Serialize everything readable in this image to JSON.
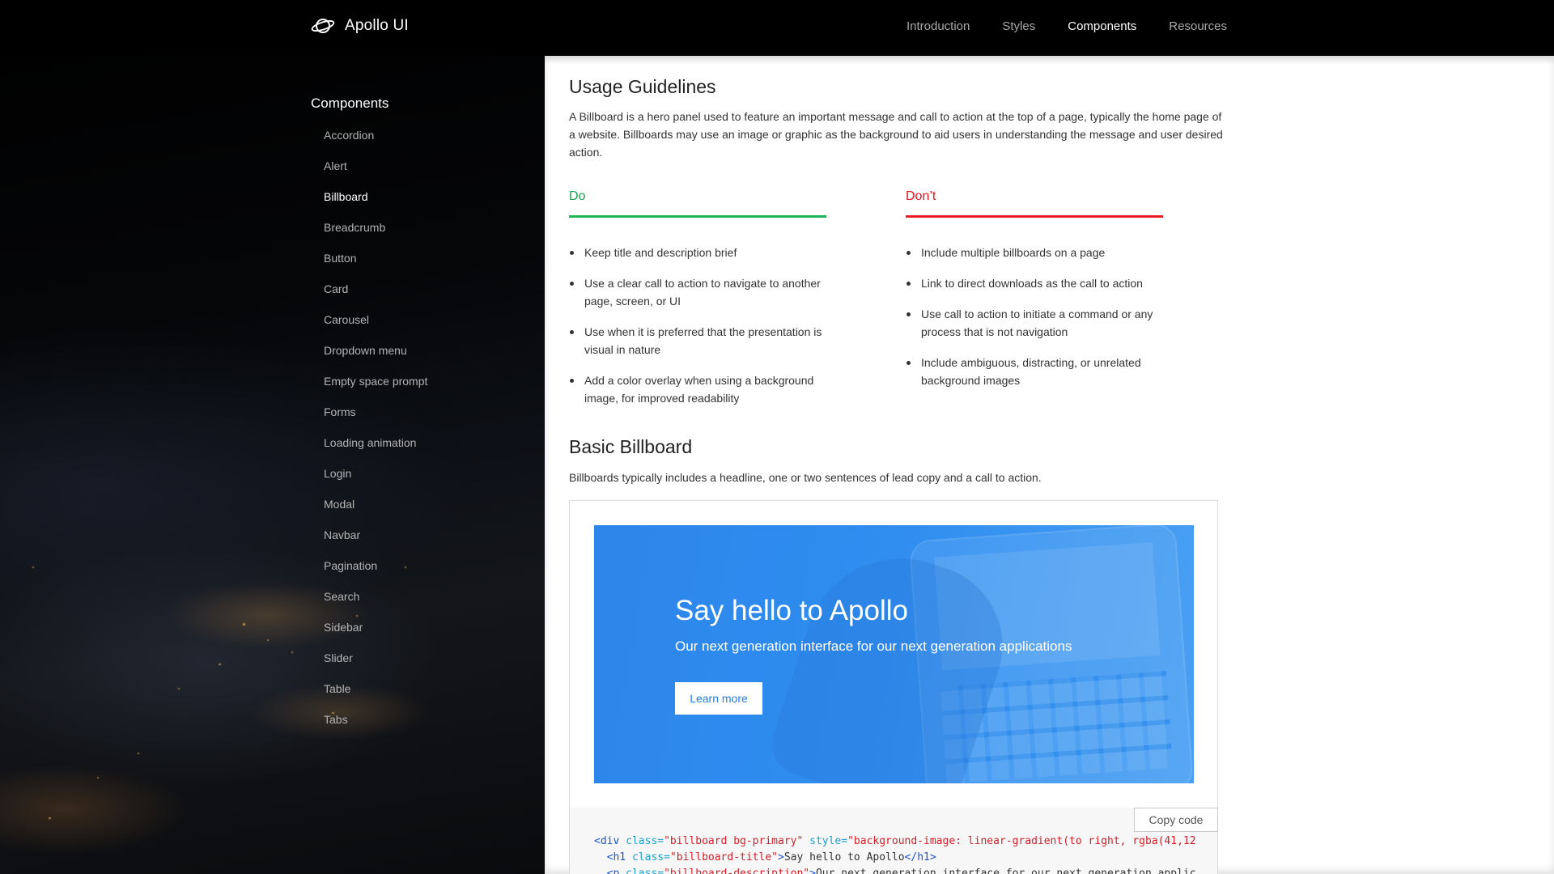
{
  "brand": {
    "name": "Apollo UI",
    "icon": "planet-icon"
  },
  "nav": {
    "links": [
      {
        "label": "Introduction",
        "active": false
      },
      {
        "label": "Styles",
        "active": false
      },
      {
        "label": "Components",
        "active": true
      },
      {
        "label": "Resources",
        "active": false
      }
    ]
  },
  "sidebar": {
    "title": "Components",
    "items": [
      {
        "label": "Accordion",
        "active": false
      },
      {
        "label": "Alert",
        "active": false
      },
      {
        "label": "Billboard",
        "active": true
      },
      {
        "label": "Breadcrumb",
        "active": false
      },
      {
        "label": "Button",
        "active": false
      },
      {
        "label": "Card",
        "active": false
      },
      {
        "label": "Carousel",
        "active": false
      },
      {
        "label": "Dropdown menu",
        "active": false
      },
      {
        "label": "Empty space prompt",
        "active": false
      },
      {
        "label": "Forms",
        "active": false
      },
      {
        "label": "Loading animation",
        "active": false
      },
      {
        "label": "Login",
        "active": false
      },
      {
        "label": "Modal",
        "active": false
      },
      {
        "label": "Navbar",
        "active": false
      },
      {
        "label": "Pagination",
        "active": false
      },
      {
        "label": "Search",
        "active": false
      },
      {
        "label": "Sidebar",
        "active": false
      },
      {
        "label": "Slider",
        "active": false
      },
      {
        "label": "Table",
        "active": false
      },
      {
        "label": "Tabs",
        "active": false
      }
    ]
  },
  "usage": {
    "title": "Usage Guidelines",
    "description": "A Billboard is a hero panel used to feature an important message and call to action at the top of a page, typically the home page of a website. Billboards may use an image or graphic as the background to aid users in understanding the message and user desired action.",
    "do": {
      "heading": "Do",
      "color": "#1fb456",
      "items": [
        "Keep title and description brief",
        "Use a clear call to action to navigate to another page, screen, or UI",
        "Use when it is preferred that the presentation is visual in nature",
        "Add a color overlay when using a background image, for improved readability"
      ]
    },
    "dont": {
      "heading": "Don’t",
      "color": "#ec1c24",
      "items": [
        "Include multiple billboards on a page",
        "Link to direct downloads as the call to action",
        "Use call to action to initiate a command or any process that is not navigation",
        "Include ambiguous, distracting, or unrelated background images"
      ]
    }
  },
  "basic": {
    "title": "Basic Billboard",
    "description": "Billboards typically includes a headline, one or two sentences of lead copy and a call to action.",
    "billboard": {
      "title": "Say hello to Apollo",
      "description": "Our next generation interface for our next generation applications",
      "button": "Learn more",
      "color": "#2f8df0"
    },
    "copy_button": "Copy code",
    "code": {
      "line1": {
        "tag_open": "<div",
        "attr1": " class=",
        "val1": "\"billboard bg-primary\"",
        "attr2": " style=",
        "val2": "\"background-image: linear-gradient(to right, rgba(41,12"
      },
      "line2": {
        "tag_open": "<h1",
        "attr1": " class=",
        "val1": "\"billboard-title\"",
        "gt": ">",
        "text": "Say hello to Apollo",
        "tag_close": "</h1>"
      },
      "line3": {
        "tag_open": "<p",
        "attr1": " class=",
        "val1": "\"billboard-description\"",
        "gt": ">",
        "text": "Our next generation interface for our next generation applic"
      }
    }
  }
}
